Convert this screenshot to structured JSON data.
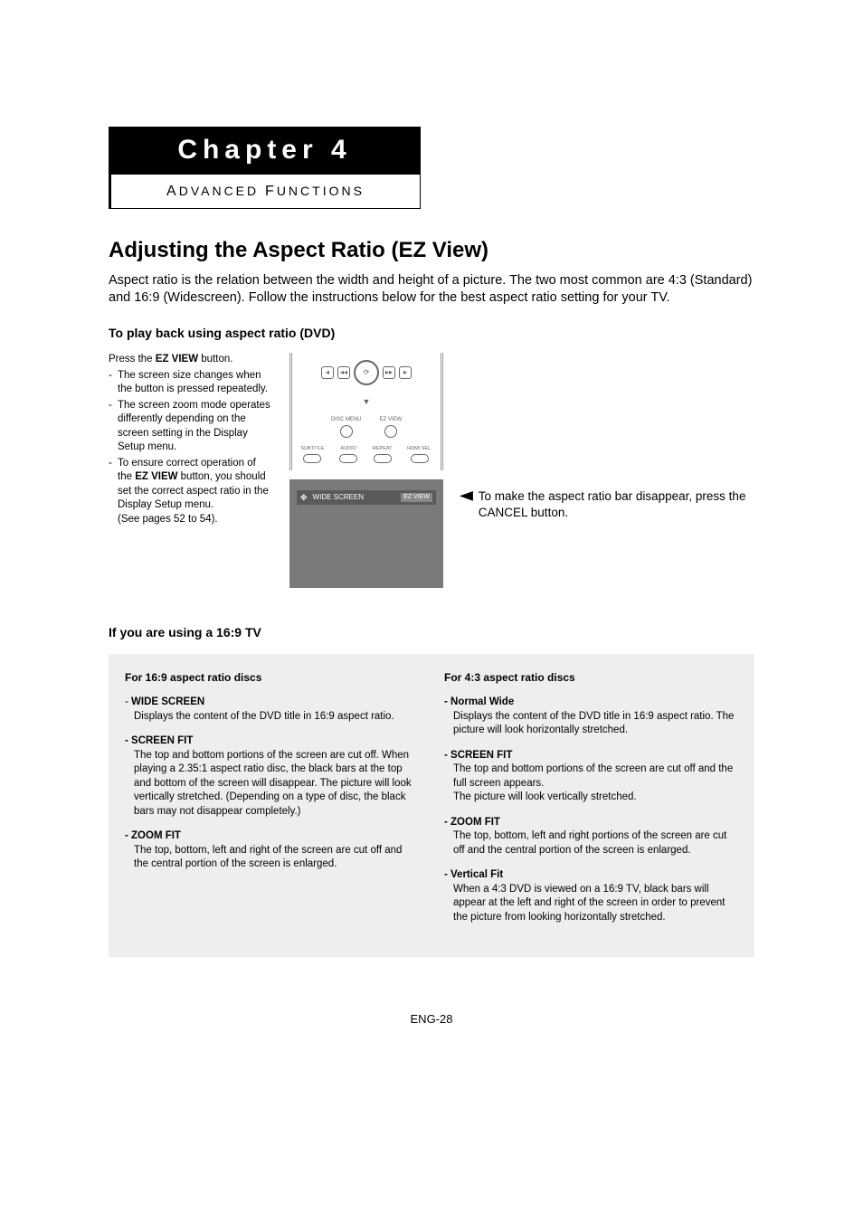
{
  "chapter": {
    "label": "Chapter 4",
    "subtitle_a": "A",
    "subtitle_b": "DVANCED ",
    "subtitle_c": "F",
    "subtitle_d": "UNCTIONS"
  },
  "title": "Adjusting the Aspect Ratio (EZ View)",
  "intro": "Aspect ratio is the relation between the width and height of a picture. The two most common are 4:3 (Standard) and 16:9 (Widescreen). Follow the instructions below for the best aspect ratio setting for your TV.",
  "section1_heading": "To play back using aspect ratio (DVD)",
  "left": {
    "line1a": "Press the ",
    "line1b": "EZ VIEW",
    "line1c": " button.",
    "bullet1": "The screen size changes when the button is pressed repeatedly.",
    "bullet2": "The screen zoom mode operates differently depending on the screen setting in the Display Setup menu.",
    "bullet3a": "To ensure correct operation of the ",
    "bullet3b": "EZ VIEW",
    "bullet3c": " button, you should set the correct aspect ratio in the Display Setup menu.",
    "bullet3d": "(See pages 52 to 54)."
  },
  "remote": {
    "disc_menu": "DISC MENU",
    "ez_view": "EZ VIEW",
    "subtitle": "SUBTITLE",
    "audio": "AUDIO",
    "repeat": "REPEAT",
    "hdmi": "HDMI SEL."
  },
  "osd": {
    "label": "WIDE SCREEN",
    "badge": "EZ VIEW"
  },
  "note": "To make the aspect ratio bar disappear, press the CANCEL button.",
  "section2_heading": "If you are using a 16:9 TV",
  "leftcol": {
    "heading": "For 16:9 aspect ratio discs",
    "i1_lead_dash": "- ",
    "i1_lead": "WIDE SCREEN",
    "i1_body": "Displays the content of the DVD title in 16:9 aspect ratio.",
    "i2_lead": "-  SCREEN FIT",
    "i2_body": "The top and bottom portions of the screen are cut off. When playing a 2.35:1 aspect ratio disc, the black bars at the top and bottom of the screen will disappear. The picture will look vertically stretched. (Depending on a type of disc, the black bars may not disappear completely.)",
    "i3_lead": "-  ZOOM FIT",
    "i3_body": "The top, bottom, left and right of the screen are cut off and the central portion of the screen is enlarged."
  },
  "rightcol": {
    "heading": "For 4:3 aspect ratio discs",
    "i1_lead": "-  Normal Wide",
    "i1_body": "Displays the content of the DVD title in 16:9 aspect ratio. The picture will look horizontally stretched.",
    "i2_lead": "-  SCREEN FIT",
    "i2_body1": "The top and bottom portions of the screen are cut off and the full screen appears.",
    "i2_body2": "The picture will look vertically stretched.",
    "i3_lead": "-  ZOOM FIT",
    "i3_body": "The top, bottom, left and right portions of the screen are cut off and the central portion of the screen is enlarged.",
    "i4_lead": "-  Vertical Fit",
    "i4_body": "When a 4:3 DVD is viewed on a 16:9 TV, black bars will appear at the left and right of the screen in order to prevent the picture from looking horizontally stretched."
  },
  "pagenum": "ENG-28"
}
